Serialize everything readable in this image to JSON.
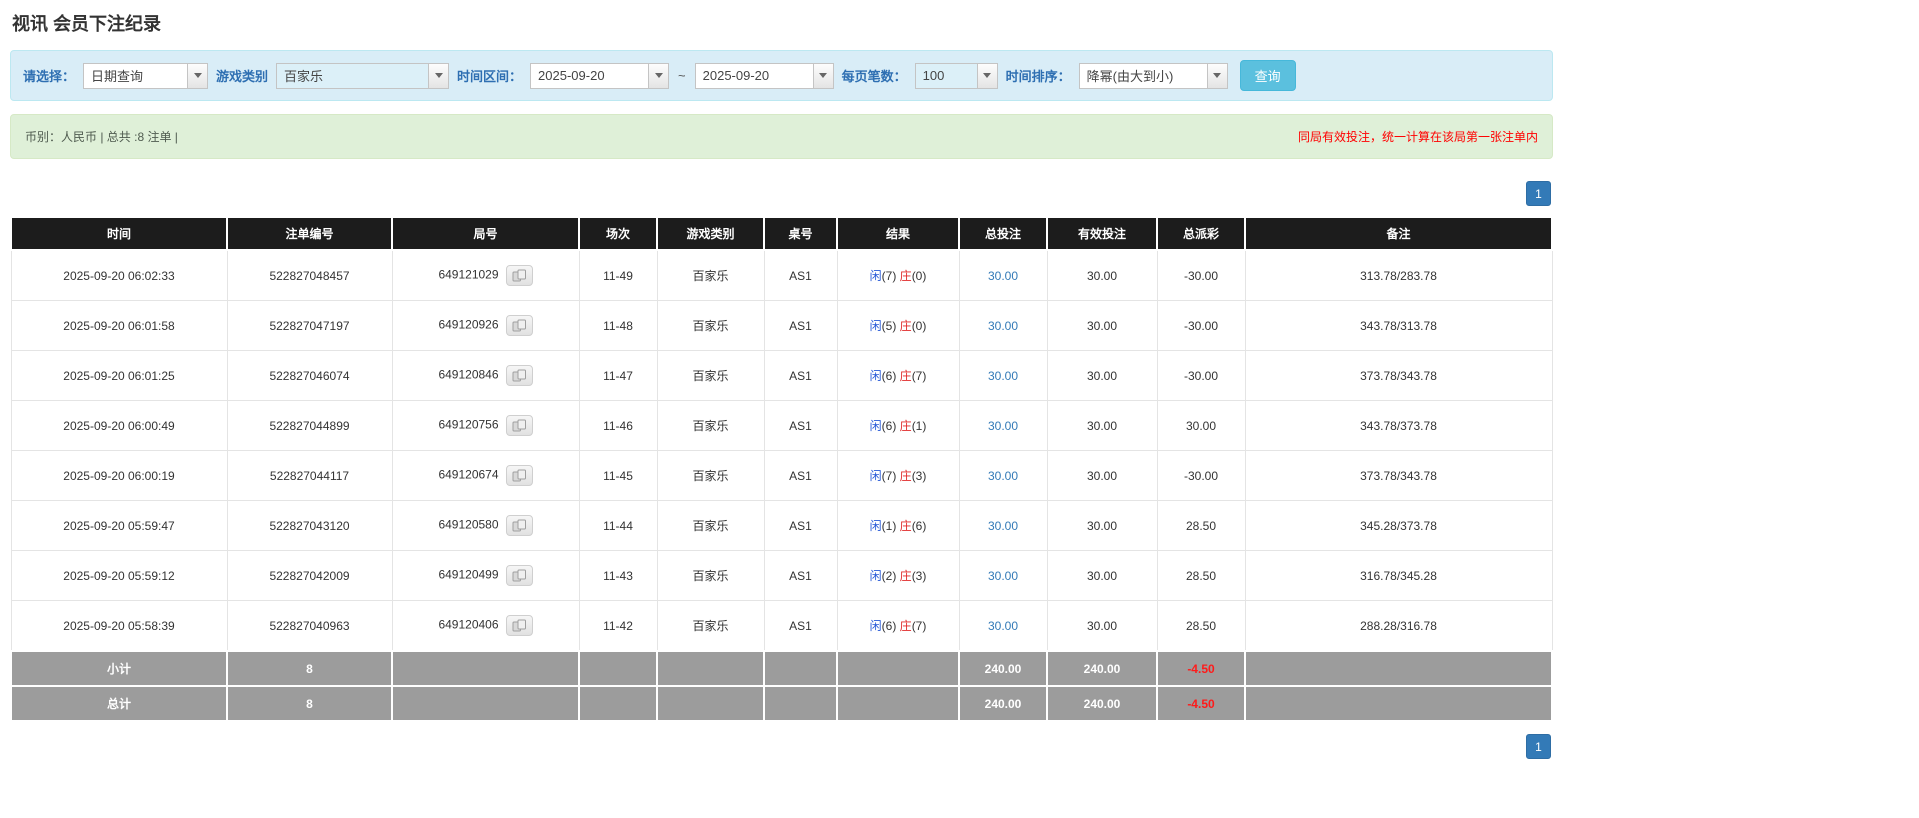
{
  "page": {
    "title": "视讯 会员下注纪录"
  },
  "filters": {
    "select_label": "请选择：",
    "select_value": "日期查询",
    "game_label": "游戏类别",
    "game_value": "百家乐",
    "range_label": "时间区间：",
    "range_from": "2025-09-20",
    "range_sep": "~",
    "range_to": "2025-09-20",
    "size_label": "每页笔数：",
    "size_value": "100",
    "sort_label": "时间排序：",
    "sort_value": "降幂(由大到小)",
    "search_button": "查询"
  },
  "notice": {
    "left": "币别：人民币 | 总共 :8 注单 |",
    "right": "同局有效投注，统一计算在该局第一张注单内"
  },
  "pagination": {
    "top": "1",
    "bottom": "1"
  },
  "table": {
    "headers": [
      "时间",
      "注单编号",
      "局号",
      "场次",
      "游戏类别",
      "桌号",
      "结果",
      "总投注",
      "有效投注",
      "总派彩",
      "备注"
    ],
    "rows": [
      {
        "time": "2025-09-20 06:02:33",
        "bet_no": "522827048457",
        "round_no": "649121029",
        "session": "11-49",
        "game": "百家乐",
        "table": "AS1",
        "player": "闲(7)",
        "banker": "庄(0)",
        "total_bet": "30.00",
        "valid_bet": "30.00",
        "payout": "-30.00",
        "remark": "313.78/283.78"
      },
      {
        "time": "2025-09-20 06:01:58",
        "bet_no": "522827047197",
        "round_no": "649120926",
        "session": "11-48",
        "game": "百家乐",
        "table": "AS1",
        "player": "闲(5)",
        "banker": "庄(0)",
        "total_bet": "30.00",
        "valid_bet": "30.00",
        "payout": "-30.00",
        "remark": "343.78/313.78"
      },
      {
        "time": "2025-09-20 06:01:25",
        "bet_no": "522827046074",
        "round_no": "649120846",
        "session": "11-47",
        "game": "百家乐",
        "table": "AS1",
        "player": "闲(6)",
        "banker": "庄(7)",
        "total_bet": "30.00",
        "valid_bet": "30.00",
        "payout": "-30.00",
        "remark": "373.78/343.78"
      },
      {
        "time": "2025-09-20 06:00:49",
        "bet_no": "522827044899",
        "round_no": "649120756",
        "session": "11-46",
        "game": "百家乐",
        "table": "AS1",
        "player": "闲(6)",
        "banker": "庄(1)",
        "total_bet": "30.00",
        "valid_bet": "30.00",
        "payout": "30.00",
        "remark": "343.78/373.78"
      },
      {
        "time": "2025-09-20 06:00:19",
        "bet_no": "522827044117",
        "round_no": "649120674",
        "session": "11-45",
        "game": "百家乐",
        "table": "AS1",
        "player": "闲(7)",
        "banker": "庄(3)",
        "total_bet": "30.00",
        "valid_bet": "30.00",
        "payout": "-30.00",
        "remark": "373.78/343.78"
      },
      {
        "time": "2025-09-20 05:59:47",
        "bet_no": "522827043120",
        "round_no": "649120580",
        "session": "11-44",
        "game": "百家乐",
        "table": "AS1",
        "player": "闲(1)",
        "banker": "庄(6)",
        "total_bet": "30.00",
        "valid_bet": "30.00",
        "payout": "28.50",
        "remark": "345.28/373.78"
      },
      {
        "time": "2025-09-20 05:59:12",
        "bet_no": "522827042009",
        "round_no": "649120499",
        "session": "11-43",
        "game": "百家乐",
        "table": "AS1",
        "player": "闲(2)",
        "banker": "庄(3)",
        "total_bet": "30.00",
        "valid_bet": "30.00",
        "payout": "28.50",
        "remark": "316.78/345.28"
      },
      {
        "time": "2025-09-20 05:58:39",
        "bet_no": "522827040963",
        "round_no": "649120406",
        "session": "11-42",
        "game": "百家乐",
        "table": "AS1",
        "player": "闲(6)",
        "banker": "庄(7)",
        "total_bet": "30.00",
        "valid_bet": "30.00",
        "payout": "28.50",
        "remark": "288.28/316.78"
      }
    ],
    "footer": [
      {
        "label": "小计",
        "count": "8",
        "total_bet": "240.00",
        "valid_bet": "240.00",
        "payout": "-4.50"
      },
      {
        "label": "总计",
        "count": "8",
        "total_bet": "240.00",
        "valid_bet": "240.00",
        "payout": "-4.50"
      }
    ],
    "icons": {
      "round_result": "cards-icon"
    }
  },
  "colors": {
    "filter_bar_bg": "#d9edf7",
    "notice_bar_bg": "#dff0d8",
    "table_header_bg": "#1c1c1c",
    "table_footer_bg": "#9c9c9c",
    "accent_blue": "#337ab7",
    "search_button_bg": "#5bc0de",
    "player_blue": "#2457d6",
    "banker_red": "#e02b2b",
    "negative_red": "#ff0000",
    "notice_red": "#ff0000",
    "filter_label_blue": "#2e6fb2"
  }
}
